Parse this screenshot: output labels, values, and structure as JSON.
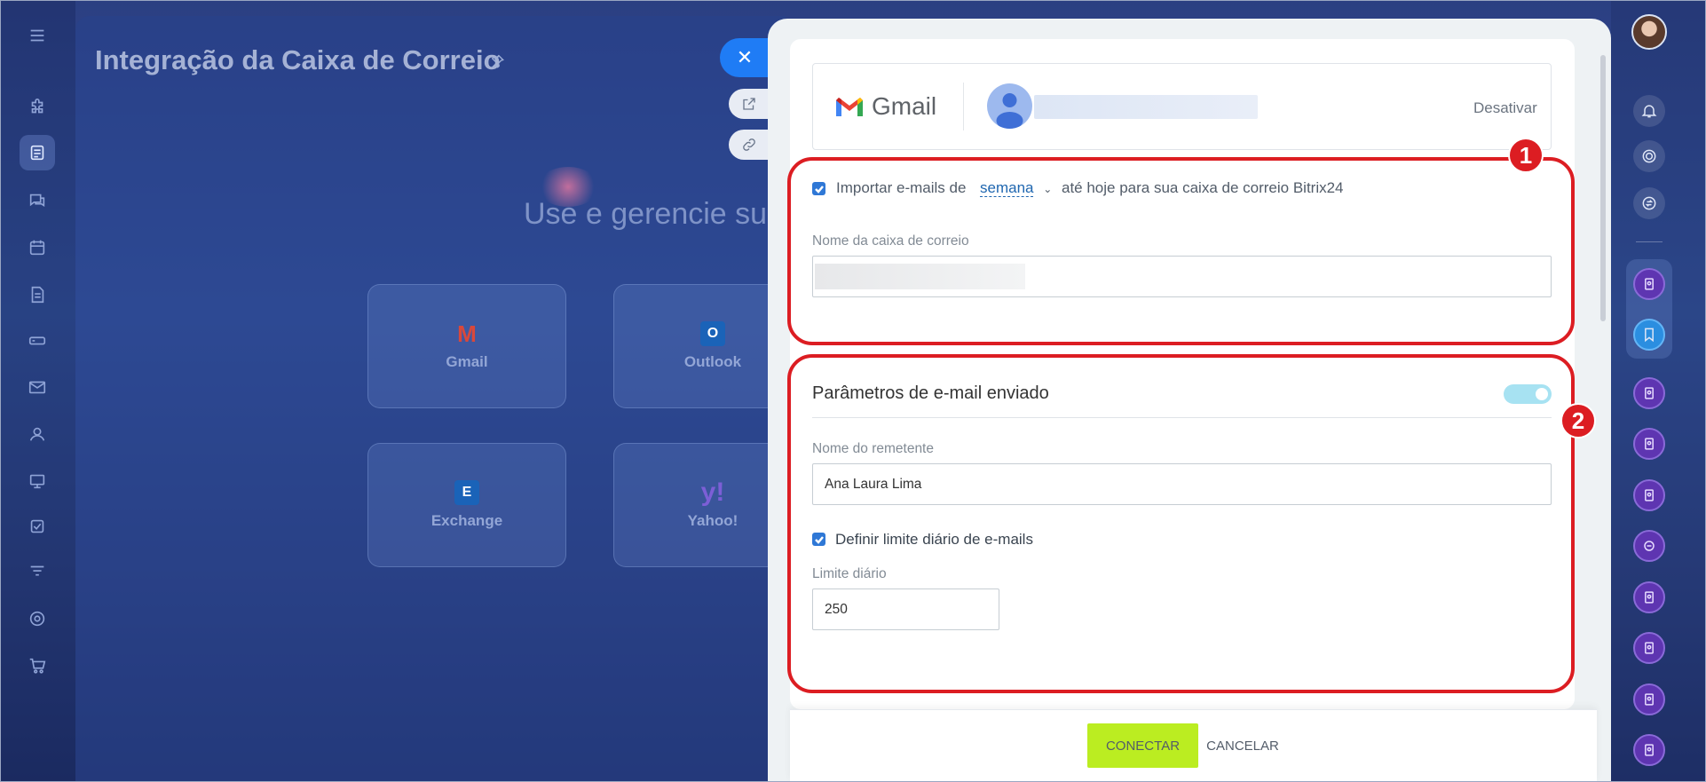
{
  "background_page": {
    "title": "Integração da Caixa de Correio",
    "subtitle": "Use e gerencie sua",
    "tiles": [
      {
        "label": "Gmail",
        "logo": "M"
      },
      {
        "label": "Outlook",
        "logo": "O"
      },
      {
        "label": "Exchange",
        "logo": "E"
      },
      {
        "label": "Yahoo!",
        "logo": "y!"
      }
    ]
  },
  "panel": {
    "provider_name": "Gmail",
    "disable_label": "Desativar",
    "import": {
      "checked": true,
      "prefix": "Importar e-mails de",
      "period": "semana",
      "suffix": "até hoje para sua caixa de correio Bitrix24"
    },
    "mailbox_name_label": "Nome da caixa de correio",
    "outgoing": {
      "title": "Parâmetros de e-mail enviado",
      "toggle_on": true,
      "sender_name_label": "Nome do remetente",
      "sender_name_value": "Ana Laura Lima",
      "daily_limit_checkbox_label": "Definir limite diário de e-mails",
      "daily_limit_checked": true,
      "daily_limit_label": "Limite diário",
      "daily_limit_value": "250"
    },
    "buttons": {
      "connect": "CONECTAR",
      "cancel": "CANCELAR"
    }
  },
  "annotations": {
    "badge_1": "1",
    "badge_2": "2"
  },
  "colors": {
    "annotation_red": "#dc1d22",
    "connect_green": "#bbed21",
    "close_blue": "#1f7cf5",
    "checkbox_blue": "#2f78d6"
  }
}
